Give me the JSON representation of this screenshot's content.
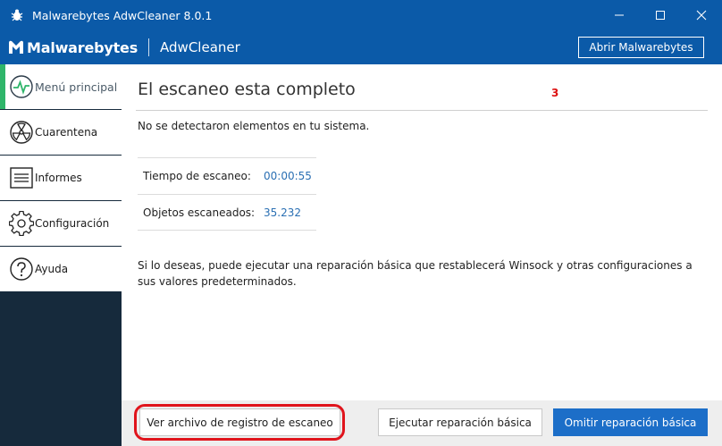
{
  "window": {
    "title": "Malwarebytes AdwCleaner 8.0.1"
  },
  "header": {
    "logo_text": "Malwarebytes",
    "product": "AdwCleaner",
    "open_button": "Abrir Malwarebytes"
  },
  "sidebar": {
    "items": [
      {
        "label": "Menú principal",
        "icon": "pulse-icon",
        "active": true
      },
      {
        "label": "Cuarentena",
        "icon": "radiation-icon",
        "active": false
      },
      {
        "label": "Informes",
        "icon": "report-icon",
        "active": false
      },
      {
        "label": "Configuración",
        "icon": "gear-icon",
        "active": false
      },
      {
        "label": "Ayuda",
        "icon": "help-icon",
        "active": false
      }
    ]
  },
  "main": {
    "heading": "El escaneo esta completo",
    "step_number": "3",
    "no_elements": "No se detectaron elementos en tu sistema.",
    "stats": [
      {
        "label": "Tiempo de escaneo:",
        "value": "00:00:55"
      },
      {
        "label": "Objetos escaneados:",
        "value": "35.232"
      }
    ],
    "repair_text": "Si lo deseas, puede ejecutar una reparación básica que restablecerá Winsock y otras configuraciones a sus valores predeterminados."
  },
  "footer": {
    "log_button": "Ver archivo de registro de escaneo",
    "basic_repair_button": "Ejecutar reparación básica",
    "skip_repair_button": "Omitir reparación básica"
  },
  "colors": {
    "titlebar": "#0b5aa8",
    "sidebar": "#162a3c",
    "accent_green": "#2fb56a",
    "primary_button": "#1c6ec8",
    "highlight_ring": "#e0141c",
    "value_blue": "#2a6fb3"
  }
}
